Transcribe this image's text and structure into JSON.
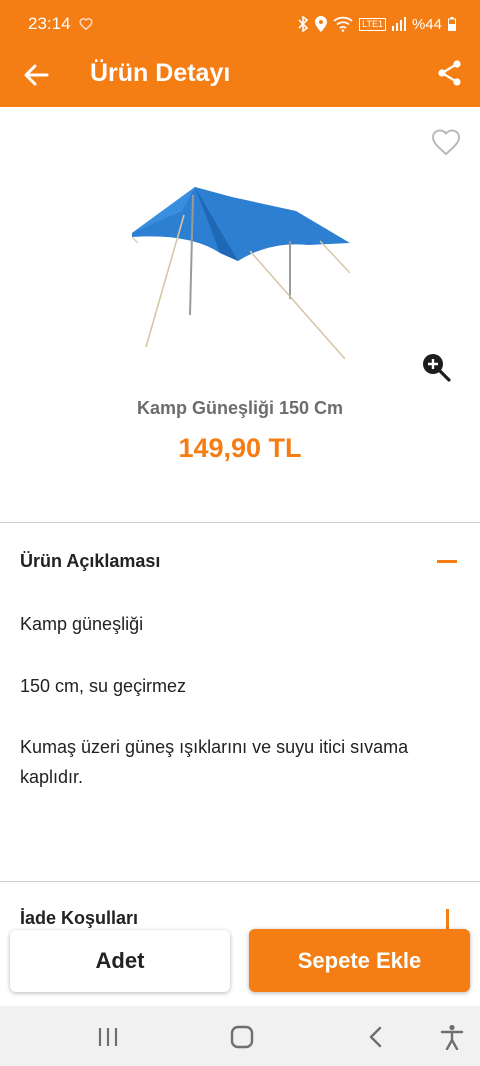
{
  "status": {
    "time": "23:14",
    "battery": "%44",
    "lte_label": "LTE1"
  },
  "app_bar": {
    "title": "Ürün Detayı",
    "back_icon": "arrow-left-icon",
    "share_icon": "share-icon"
  },
  "product": {
    "name": "Kamp Güneşliği 150 Cm",
    "price": "149,90 TL",
    "favorite_icon": "heart-outline-icon",
    "zoom_icon": "zoom-in-icon",
    "image_desc": "blue-tarp-shade"
  },
  "description": {
    "header": "Ürün Açıklaması",
    "lines": [
      "Kamp güneşliği",
      "150 cm, su geçirmez",
      "Kumaş üzeri güneş ışıklarını ve suyu itici sıvama kaplıdır."
    ]
  },
  "next_section": {
    "header": "İade Koşulları"
  },
  "actions": {
    "quantity_label": "Adet",
    "add_to_cart_label": "Sepete Ekle"
  },
  "colors": {
    "brand": "#f47d14",
    "text": "#222222",
    "muted": "#6d6d6d"
  }
}
